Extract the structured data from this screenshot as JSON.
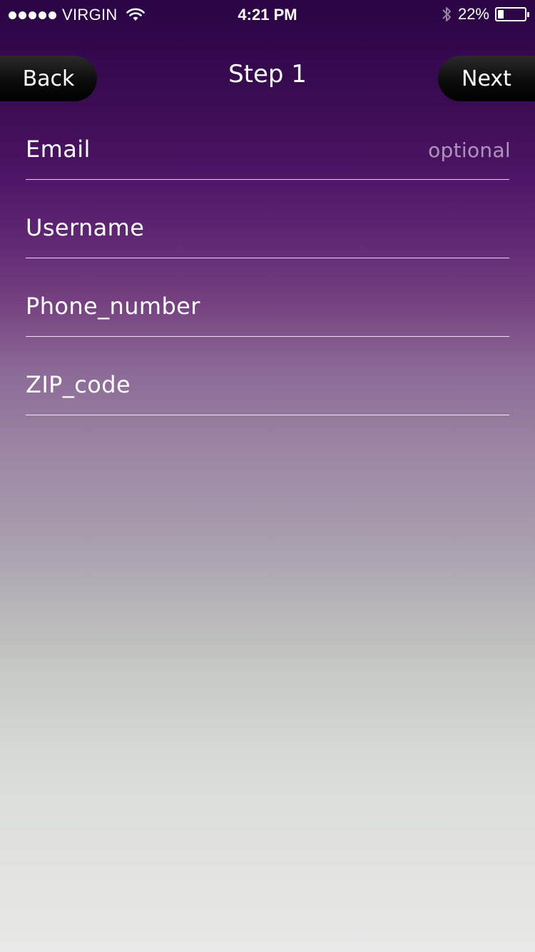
{
  "status_bar": {
    "carrier": "VIRGIN",
    "time": "4:21 PM",
    "battery_percent": "22%",
    "battery_level": 0.22,
    "signal_dots": 5,
    "icons": [
      "signal-dots-icon",
      "wifi-icon",
      "bluetooth-icon",
      "battery-icon"
    ]
  },
  "nav": {
    "title": "Step 1",
    "back_label": "Back",
    "next_label": "Next"
  },
  "form": {
    "fields": [
      {
        "label": "Email",
        "hint": "optional"
      },
      {
        "label": "Username",
        "hint": ""
      },
      {
        "label": "Phone_number",
        "hint": ""
      },
      {
        "label": "ZIP_code",
        "hint": ""
      }
    ]
  },
  "colors": {
    "gradient_top": "#2a0445",
    "gradient_mid": "#9a83a2",
    "gradient_bottom": "#e8e8e8",
    "button_bg": "#000000",
    "text": "#ffffff"
  }
}
